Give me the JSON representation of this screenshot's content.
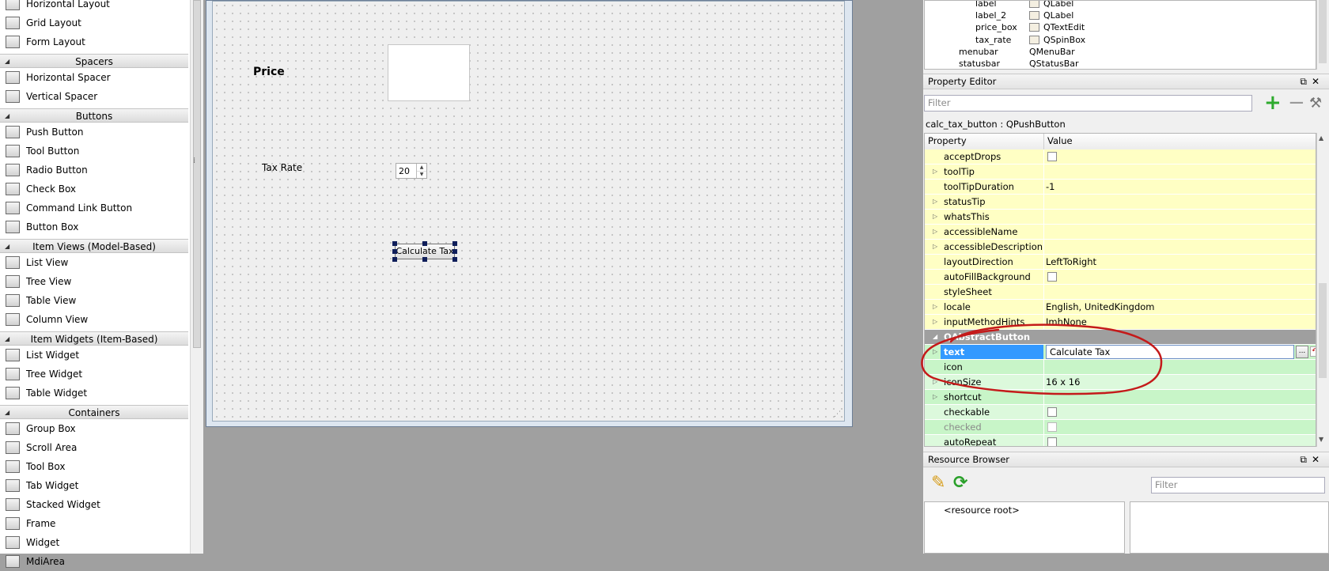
{
  "widget_box": {
    "rows": [
      {
        "kind": "item",
        "label": "Horizontal Layout",
        "icon": "horizontal-layout-icon"
      },
      {
        "kind": "item",
        "label": "Grid Layout",
        "icon": "grid-layout-icon"
      },
      {
        "kind": "item",
        "label": "Form Layout",
        "icon": "form-layout-icon"
      },
      {
        "kind": "cat",
        "label": "Spacers"
      },
      {
        "kind": "item",
        "label": "Horizontal Spacer",
        "icon": "horizontal-spacer-icon"
      },
      {
        "kind": "item",
        "label": "Vertical Spacer",
        "icon": "vertical-spacer-icon"
      },
      {
        "kind": "cat",
        "label": "Buttons"
      },
      {
        "kind": "item",
        "label": "Push Button",
        "icon": "push-button-icon"
      },
      {
        "kind": "item",
        "label": "Tool Button",
        "icon": "tool-button-icon"
      },
      {
        "kind": "item",
        "label": "Radio Button",
        "icon": "radio-button-icon"
      },
      {
        "kind": "item",
        "label": "Check Box",
        "icon": "check-box-icon"
      },
      {
        "kind": "item",
        "label": "Command Link Button",
        "icon": "command-link-icon"
      },
      {
        "kind": "item",
        "label": "Button Box",
        "icon": "button-box-icon"
      },
      {
        "kind": "cat",
        "label": "Item Views (Model-Based)"
      },
      {
        "kind": "item",
        "label": "List View",
        "icon": "list-view-icon"
      },
      {
        "kind": "item",
        "label": "Tree View",
        "icon": "tree-view-icon"
      },
      {
        "kind": "item",
        "label": "Table View",
        "icon": "table-view-icon"
      },
      {
        "kind": "item",
        "label": "Column View",
        "icon": "column-view-icon"
      },
      {
        "kind": "cat",
        "label": "Item Widgets (Item-Based)"
      },
      {
        "kind": "item",
        "label": "List Widget",
        "icon": "list-widget-icon"
      },
      {
        "kind": "item",
        "label": "Tree Widget",
        "icon": "tree-widget-icon"
      },
      {
        "kind": "item",
        "label": "Table Widget",
        "icon": "table-widget-icon"
      },
      {
        "kind": "cat",
        "label": "Containers"
      },
      {
        "kind": "item",
        "label": "Group Box",
        "icon": "group-box-icon"
      },
      {
        "kind": "item",
        "label": "Scroll Area",
        "icon": "scroll-area-icon"
      },
      {
        "kind": "item",
        "label": "Tool Box",
        "icon": "tool-box-icon"
      },
      {
        "kind": "item",
        "label": "Tab Widget",
        "icon": "tab-widget-icon"
      },
      {
        "kind": "item",
        "label": "Stacked Widget",
        "icon": "stacked-widget-icon"
      },
      {
        "kind": "item",
        "label": "Frame",
        "icon": "frame-icon"
      },
      {
        "kind": "item",
        "label": "Widget",
        "icon": "widget-icon"
      },
      {
        "kind": "item",
        "label": "MdiArea",
        "icon": "mdi-area-icon"
      }
    ]
  },
  "form": {
    "price_label": "Price",
    "tax_rate_label": "Tax Rate",
    "tax_rate_value": "20",
    "calc_button_label": "Calculate Tax"
  },
  "object_inspector": {
    "rows": [
      {
        "name": "label",
        "class": "QLabel",
        "indent": 2,
        "icon": "label-icon"
      },
      {
        "name": "label_2",
        "class": "QLabel",
        "indent": 2,
        "icon": "label-icon"
      },
      {
        "name": "price_box",
        "class": "QTextEdit",
        "indent": 2,
        "icon": "text-edit-icon"
      },
      {
        "name": "tax_rate",
        "class": "QSpinBox",
        "indent": 2,
        "icon": "spin-box-icon"
      },
      {
        "name": "menubar",
        "class": "QMenuBar",
        "indent": 1,
        "icon": ""
      },
      {
        "name": "statusbar",
        "class": "QStatusBar",
        "indent": 1,
        "icon": ""
      }
    ]
  },
  "property_editor": {
    "title": "Property Editor",
    "filter_placeholder": "Filter",
    "object_name": "calc_tax_button : QPushButton",
    "col_property": "Property",
    "col_value": "Value",
    "rows": [
      {
        "name": "acceptDrops",
        "value": "",
        "checkbox": true,
        "expand": false,
        "style": "yellow"
      },
      {
        "name": "toolTip",
        "value": "",
        "checkbox": false,
        "expand": true,
        "style": "yellow"
      },
      {
        "name": "toolTipDuration",
        "value": "-1",
        "checkbox": false,
        "expand": false,
        "style": "yellow"
      },
      {
        "name": "statusTip",
        "value": "",
        "checkbox": false,
        "expand": true,
        "style": "yellow"
      },
      {
        "name": "whatsThis",
        "value": "",
        "checkbox": false,
        "expand": true,
        "style": "yellow"
      },
      {
        "name": "accessibleName",
        "value": "",
        "checkbox": false,
        "expand": true,
        "style": "yellow"
      },
      {
        "name": "accessibleDescription",
        "value": "",
        "checkbox": false,
        "expand": true,
        "style": "yellow"
      },
      {
        "name": "layoutDirection",
        "value": "LeftToRight",
        "checkbox": false,
        "expand": false,
        "style": "yellow"
      },
      {
        "name": "autoFillBackground",
        "value": "",
        "checkbox": true,
        "expand": false,
        "style": "yellow"
      },
      {
        "name": "styleSheet",
        "value": "",
        "checkbox": false,
        "expand": false,
        "style": "yellow"
      },
      {
        "name": "locale",
        "value": "English, UnitedKingdom",
        "checkbox": false,
        "expand": true,
        "style": "yellow"
      },
      {
        "name": "inputMethodHints",
        "value": "ImhNone",
        "checkbox": false,
        "expand": true,
        "style": "yellow"
      },
      {
        "name": "QAbstractButton",
        "value": "",
        "checkbox": false,
        "expand": false,
        "style": "grey"
      },
      {
        "name": "text",
        "value": "Calculate Tax",
        "checkbox": false,
        "expand": true,
        "style": "edit"
      },
      {
        "name": "icon",
        "value": "",
        "checkbox": false,
        "expand": false,
        "style": "green"
      },
      {
        "name": "iconSize",
        "value": "16 x 16",
        "checkbox": false,
        "expand": true,
        "style": "green2"
      },
      {
        "name": "shortcut",
        "value": "",
        "checkbox": false,
        "expand": true,
        "style": "green"
      },
      {
        "name": "checkable",
        "value": "",
        "checkbox": true,
        "expand": false,
        "style": "green2"
      },
      {
        "name": "checked",
        "value": "",
        "checkbox": true,
        "expand": false,
        "style": "green"
      },
      {
        "name": "autoRepeat",
        "value": "",
        "checkbox": true,
        "expand": false,
        "style": "green2"
      }
    ]
  },
  "resource_browser": {
    "title": "Resource Browser",
    "filter_placeholder": "Filter",
    "root_label": "<resource root>"
  },
  "colors": {
    "property_yellow": "#ffffc4",
    "property_green": "#c8f5c8",
    "section_grey": "#9f9f9f",
    "annotation_red": "#c41a1a"
  }
}
